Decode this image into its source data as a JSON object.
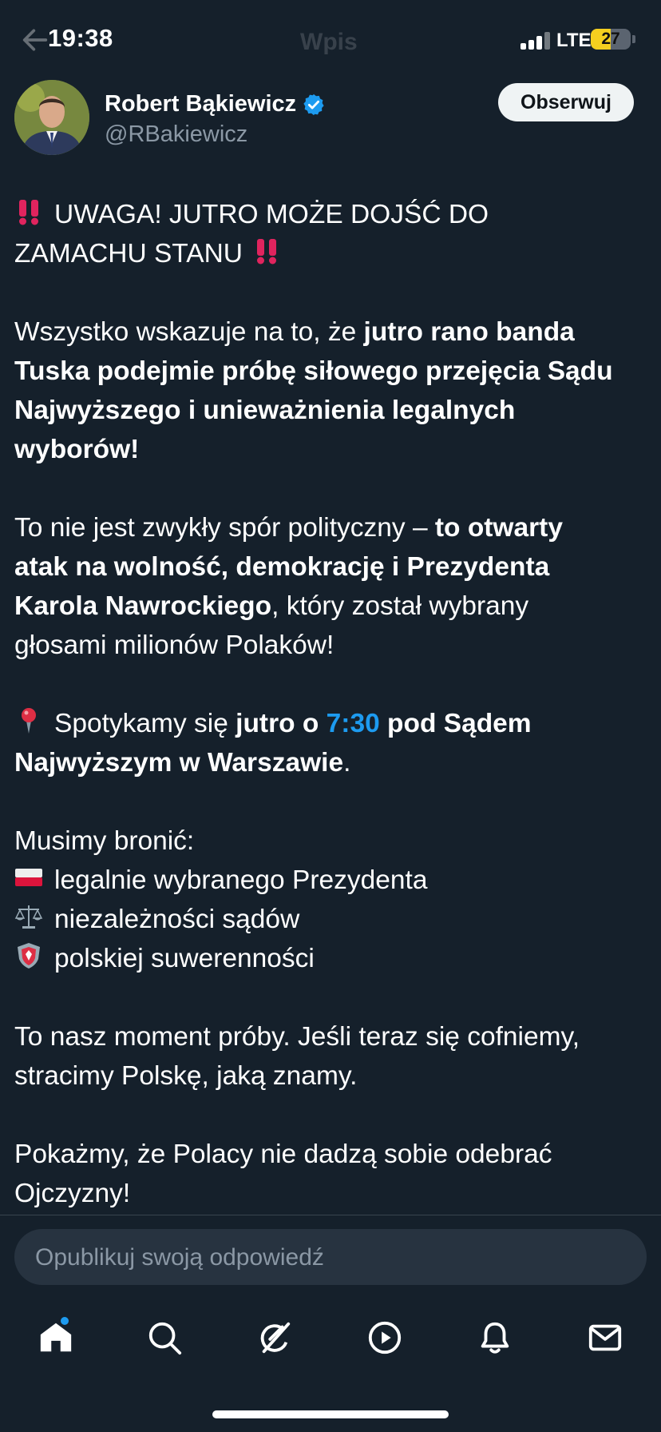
{
  "status": {
    "time": "19:38",
    "network": "LTE",
    "battery": "27",
    "faded_title": "Wpis"
  },
  "author": {
    "name": "Robert Bąkiewicz",
    "handle": "@RBakiewicz",
    "follow_label": "Obserwuj",
    "verified": true
  },
  "tweet": {
    "p1_l1": "UWAGA! JUTRO MOŻE DOJŚĆ DO",
    "p1_l2": "ZAMACHU STANU",
    "p2_l1_a": "Wszystko wskazuje na to, że ",
    "p2_l1_b": "jutro rano banda",
    "p2_l2": "Tuska podejmie próbę siłowego przejęcia Sądu",
    "p2_l3": "Najwyższego i unieważnienia legalnych",
    "p2_l4": "wyborów!",
    "p3_l1_a": "To nie jest zwykły spór polityczny – ",
    "p3_l1_b": "to otwarty",
    "p3_l2": "atak na wolność, demokrację i Prezydenta",
    "p3_l3_a": "Karola Nawrockiego",
    "p3_l3_b": ", który został wybrany",
    "p3_l4": "głosami milionów Polaków!",
    "p4_l1_a": "Spotykamy się ",
    "p4_l1_b": "jutro o ",
    "p4_l1_link": "7:30",
    "p4_l1_c": " pod Sądem",
    "p4_l2_a": "Najwyższym w Warszawie",
    "p4_l2_b": ".",
    "p5_l1": "Musimy bronić:",
    "p5_l2": "legalnie wybranego Prezydenta",
    "p5_l3": "niezależności sądów",
    "p5_l4": "polskiej suwerenności",
    "p6_l1": "To nasz moment próby. Jeśli teraz się cofniemy,",
    "p6_l2": "stracimy Polskę, jaką znamy.",
    "p7_l1": "Pokażmy, że Polacy nie dadzą sobie odebrać",
    "p7_l2": "Ojczyzny!"
  },
  "reply": {
    "placeholder": "Opublikuj swoją odpowiedź",
    "value": ""
  },
  "nav": [
    "home-icon",
    "search-icon",
    "grok-icon",
    "video-icon",
    "notifications-icon",
    "messages-icon"
  ],
  "colors": {
    "background": "#15202b",
    "accent": "#1d9bf0",
    "muted": "#8b98a5",
    "battery": "#f5cf1f",
    "alert": "#e0245e"
  }
}
